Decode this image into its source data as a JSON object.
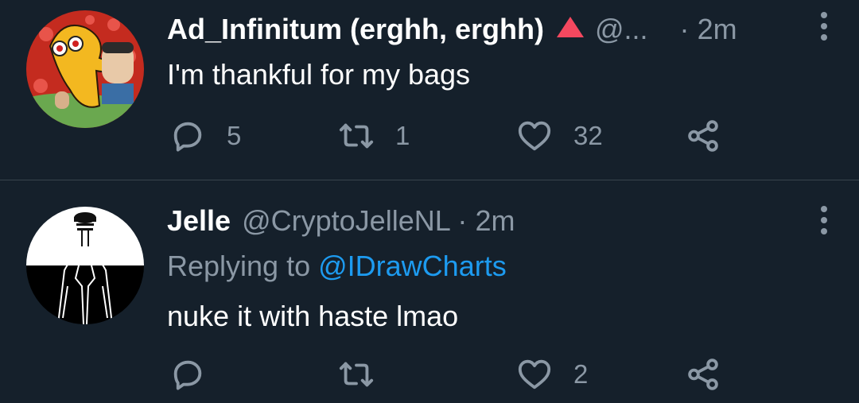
{
  "tweets": [
    {
      "name": "Ad_Infinitum (erghh, erghh)",
      "handle": "@...",
      "separator": "·",
      "time": "2m",
      "text": "I'm thankful for my bags",
      "reply_count": "5",
      "retweet_count": "1",
      "like_count": "32"
    },
    {
      "name": "Jelle",
      "handle": "@CryptoJelleNL",
      "separator": "·",
      "time": "2m",
      "replying_prefix": "Replying to",
      "replying_to": "@IDrawCharts",
      "text": "nuke it with haste lmao",
      "reply_count": "",
      "retweet_count": "",
      "like_count": "2"
    }
  ],
  "colors": {
    "background": "#15202b",
    "secondary_text": "#8b98a5",
    "link": "#1d9bf0",
    "badge": "#f4485f",
    "divider": "#38444d"
  },
  "icons": {
    "reply": "speech-bubble-icon",
    "retweet": "retweet-arrows-icon",
    "like": "heart-icon",
    "share": "share-nodes-icon",
    "more": "vertical-ellipsis-icon",
    "badge": "red-triangle-icon"
  }
}
